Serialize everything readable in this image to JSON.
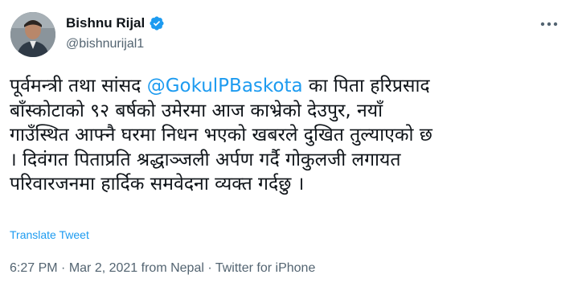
{
  "tweet": {
    "author": {
      "display_name": "Bishnu Rijal",
      "handle": "@bishnurijal1",
      "verified": true
    },
    "text_lines": [
      {
        "before": "पूर्वमन्त्री तथा सांसद ",
        "mention": "@GokulPBaskota",
        "after": " का पिता हरिप्रसाद"
      },
      {
        "text": "बाँस्कोटाको ९२ बर्षको उमेरमा आज काभ्रेको देउपुर, नयाँ"
      },
      {
        "text": "गाउँस्थित आफ्नै घरमा निधन भएको खबरले दुखित तुल्याएको छ"
      },
      {
        "text": "। दिवंगत पिताप्रति श्रद्धाञ्जली अर्पण गर्दै गोकुलजी लगायत"
      },
      {
        "text": "परिवारजनमा हार्दिक समवेदना व्यक्त गर्दछु ।"
      }
    ],
    "translate_label": "Translate Tweet",
    "meta": {
      "time": "6:27 PM",
      "separator": " · ",
      "date": "Mar 2, 2021",
      "location": " from Nepal",
      "separator2": " · ",
      "source": "Twitter for iPhone"
    },
    "colors": {
      "link": "#1d9bf0",
      "secondary_text": "#536471",
      "primary_text": "#0f1419"
    },
    "icons": {
      "verified": "verified-badge-icon",
      "more": "more-horizontal-icon"
    }
  }
}
